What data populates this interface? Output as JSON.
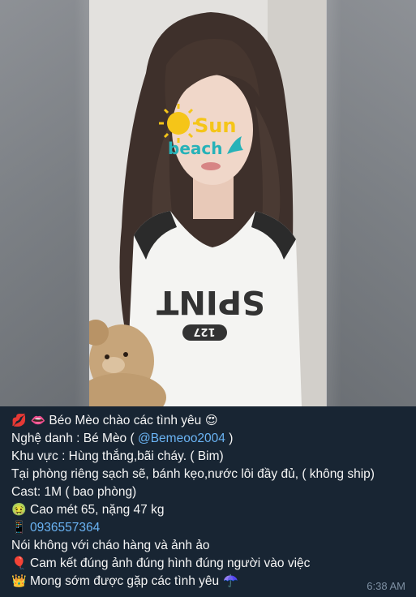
{
  "message": {
    "lines": [
      {
        "emoji": "💋 👄",
        "text": " Béo Mèo chào các tình yêu",
        "emoji_after": " 😍"
      },
      {
        "text": "Nghệ danh : Bé Mèo ( ",
        "link": "@Bemeoo2004",
        "text_after": " )"
      },
      {
        "text": "Khu vực : Hùng thắng,bãi cháy. ( Bim)"
      },
      {
        "text": "Tại phòng riêng sạch sẽ, bánh kẹo,nước lôi đầy đủ, ( không ship)"
      },
      {
        "text": "Cast: 1M ( bao phòng)"
      },
      {
        "emoji": "🤢",
        "text": " Cao mét 65, nặng 47 kg"
      },
      {
        "emoji": "📱",
        "link": " 0936557364"
      },
      {
        "text": "Nói không với cháo hàng và ảnh ảo"
      },
      {
        "emoji": "🎈",
        "text": " Cam kết đúng ảnh đúng hình đúng người vào việc"
      },
      {
        "emoji": "👑",
        "text": " Mong sớm được gặp các tình yêu",
        "emoji_after": " ☂️"
      }
    ],
    "timestamp": "6:38 AM"
  },
  "photo": {
    "logo_line1": "Sun",
    "logo_line2": "beach",
    "shirt_text": "SPINT",
    "shirt_number": "127"
  }
}
